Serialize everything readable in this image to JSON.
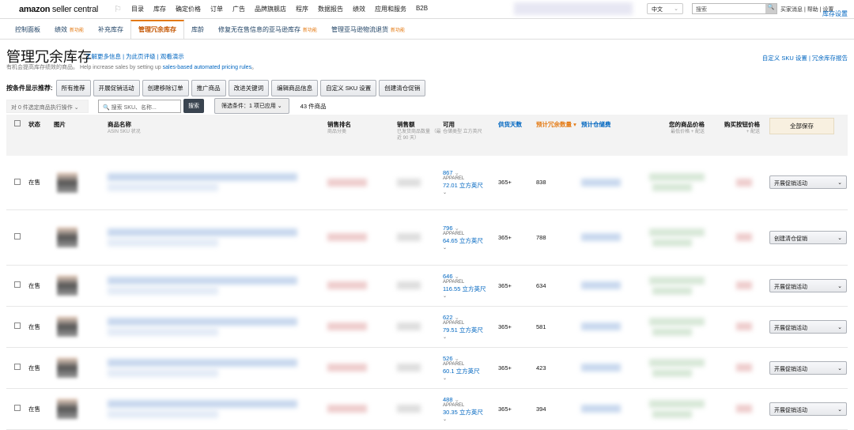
{
  "header": {
    "logo": "amazon",
    "logo_suffix": "seller central",
    "nav": [
      "目录",
      "库存",
      "确定价格",
      "订单",
      "广告",
      "品牌旗舰店",
      "程序",
      "数据报告",
      "绩效",
      "应用和服务",
      "B2B"
    ],
    "language": "中文",
    "search_placeholder": "搜索",
    "links": "买家消息 | 帮助 | 设置"
  },
  "tabs": [
    {
      "label": "控制面板"
    },
    {
      "label": "绩效",
      "badge": "新功能"
    },
    {
      "label": "补充库存"
    },
    {
      "label": "管理冗余库存",
      "active": true
    },
    {
      "label": "库龄"
    },
    {
      "label": "修复无在售信息的亚马逊库存",
      "badge": "新功能"
    },
    {
      "label": "管理亚马逊物流退货",
      "badge": "新功能"
    }
  ],
  "tab_right": "库存设置",
  "page": {
    "title": "管理冗余库存",
    "links": "了解更多信息 | 为此页评级 | 观看演示",
    "right_links": "自定义 SKU 设置 | 冗余库存报告",
    "desc_prefix": "有机会提高库存绩效的商品。 Help increase sales by setting up ",
    "desc_link": "sales-based automated pricing rules",
    "desc_suffix": "。"
  },
  "recommend": {
    "label": "按条件显示推荐:",
    "buttons": [
      "所有推荐",
      "开展促销活动",
      "创建移除订单",
      "推广商品",
      "改进关键词",
      "编辑商品信息",
      "自定义 SKU 设置",
      "创建清仓促销"
    ]
  },
  "actions": {
    "bulk": "对 0 件选定商品执行操作",
    "search_placeholder": "搜索 SKU、名称...",
    "search_btn": "搜索",
    "filter": "筛选条件：1 项已应用",
    "count": "43 件商品"
  },
  "columns": {
    "status": "状态",
    "image": "图片",
    "name": "商品名称",
    "name_sub": "ASIN SKU 状况",
    "rank": "销售排名",
    "rank_sub": "商品分类",
    "sales": "销售额",
    "sales_sub": "已发货商品数量 （最近 90 天）",
    "avail": "可用",
    "avail_sub": "仓储类型 立方英尺",
    "days": "供货天数",
    "excess": "预计冗余数量",
    "storage": "预计仓储费",
    "price": "您的商品价格",
    "price_sub": "最低价格 + 配送",
    "buybox": "购买按钮价格",
    "buybox_sub": "+ 配送",
    "save_all": "全部保存"
  },
  "rows": [
    {
      "status": "在售",
      "avail": "867",
      "type": "APPAREL",
      "cuft": "72.01 立方英尺",
      "days": "365+",
      "excess": "838",
      "action": "开展促销活动"
    },
    {
      "status": "",
      "avail": "796",
      "type": "APPAREL",
      "cuft": "64.65 立方英尺",
      "days": "365+",
      "excess": "788",
      "action": "创建清仓促销"
    },
    {
      "status": "在售",
      "avail": "646",
      "type": "APPAREL",
      "cuft": "116.55 立方英尺",
      "days": "365+",
      "excess": "634",
      "action": "开展促销活动"
    },
    {
      "status": "在售",
      "avail": "622",
      "type": "APPAREL",
      "cuft": "79.51 立方英尺",
      "days": "365+",
      "excess": "581",
      "action": "开展促销活动"
    },
    {
      "status": "在售",
      "avail": "526",
      "type": "APPAREL",
      "cuft": "60.1 立方英尺",
      "days": "365+",
      "excess": "423",
      "action": "开展促销活动"
    },
    {
      "status": "在售",
      "avail": "488",
      "type": "APPAREL",
      "cuft": "30.35 立方英尺",
      "days": "365+",
      "excess": "394",
      "action": "开展促销活动"
    }
  ]
}
